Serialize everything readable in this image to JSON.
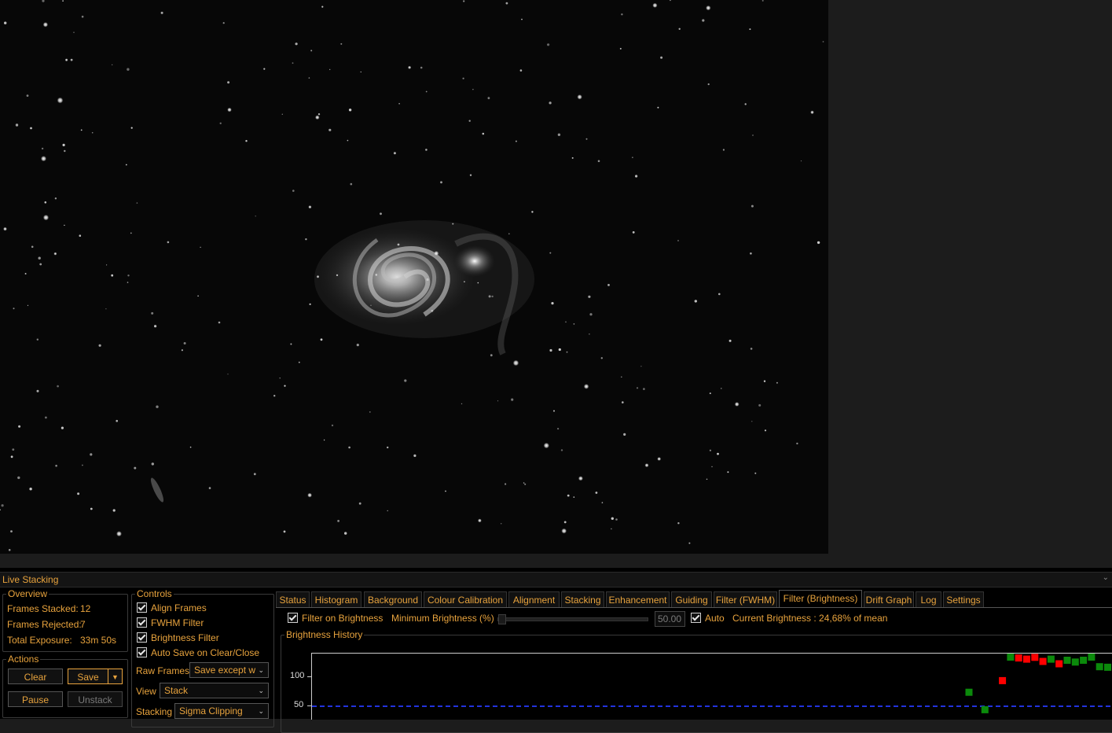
{
  "panel": {
    "title": "Live Stacking",
    "overview": {
      "legend": "Overview",
      "frames_stacked_label": "Frames Stacked:",
      "frames_stacked_value": "12",
      "frames_rejected_label": "Frames Rejected:",
      "frames_rejected_value": "7",
      "total_exposure_label": "Total Exposure:",
      "total_exposure_value": "33m 50s"
    },
    "actions": {
      "legend": "Actions",
      "clear": "Clear",
      "save": "Save",
      "pause": "Pause",
      "unstack": "Unstack"
    },
    "controls": {
      "legend": "Controls",
      "align_frames": "Align Frames",
      "fwhm_filter": "FWHM Filter",
      "brightness_filter": "Brightness Filter",
      "auto_save": "Auto Save on Clear/Close",
      "raw_frames_label": "Raw Frames",
      "raw_frames_value": "Save except w",
      "view_label": "View",
      "view_value": "Stack",
      "stacking_label": "Stacking",
      "stacking_value": "Sigma Clipping"
    },
    "tabs": [
      "Status",
      "Histogram",
      "Background",
      "Colour Calibration",
      "Alignment",
      "Stacking",
      "Enhancement",
      "Guiding",
      "Filter (FWHM)",
      "Filter (Brightness)",
      "Drift Graph",
      "Log",
      "Settings"
    ],
    "active_tab": "Filter (Brightness)",
    "brightness": {
      "filter_on_brightness": "Filter on Brightness",
      "minimum_label": "Minimum Brightness (%)",
      "minimum_value": "50.00",
      "auto_label": "Auto",
      "current": "Current Brightness : 24,68% of mean",
      "history_legend": "Brightness History"
    }
  },
  "chart_data": {
    "type": "scatter",
    "title": "Brightness History",
    "y_ticks": [
      "100",
      "50"
    ],
    "threshold": 50,
    "colors": {
      "accepted": "#0b8a0b",
      "rejected": "#ff0000",
      "threshold": "#2233dd"
    },
    "points": [
      {
        "y": 74,
        "status": "accepted"
      },
      {
        "y": 44,
        "status": "accepted"
      },
      {
        "y": 94,
        "status": "rejected"
      },
      {
        "y": 137,
        "status": "accepted"
      },
      {
        "y": 133,
        "status": "rejected"
      },
      {
        "y": 131,
        "status": "rejected"
      },
      {
        "y": 134,
        "status": "rejected"
      },
      {
        "y": 127,
        "status": "rejected"
      },
      {
        "y": 131,
        "status": "accepted"
      },
      {
        "y": 123,
        "status": "rejected"
      },
      {
        "y": 129,
        "status": "accepted"
      },
      {
        "y": 126,
        "status": "accepted"
      },
      {
        "y": 129,
        "status": "accepted"
      },
      {
        "y": 136,
        "status": "accepted"
      },
      {
        "y": 118,
        "status": "accepted"
      },
      {
        "y": 117,
        "status": "accepted"
      },
      {
        "y": 62,
        "status": "accepted"
      }
    ]
  }
}
